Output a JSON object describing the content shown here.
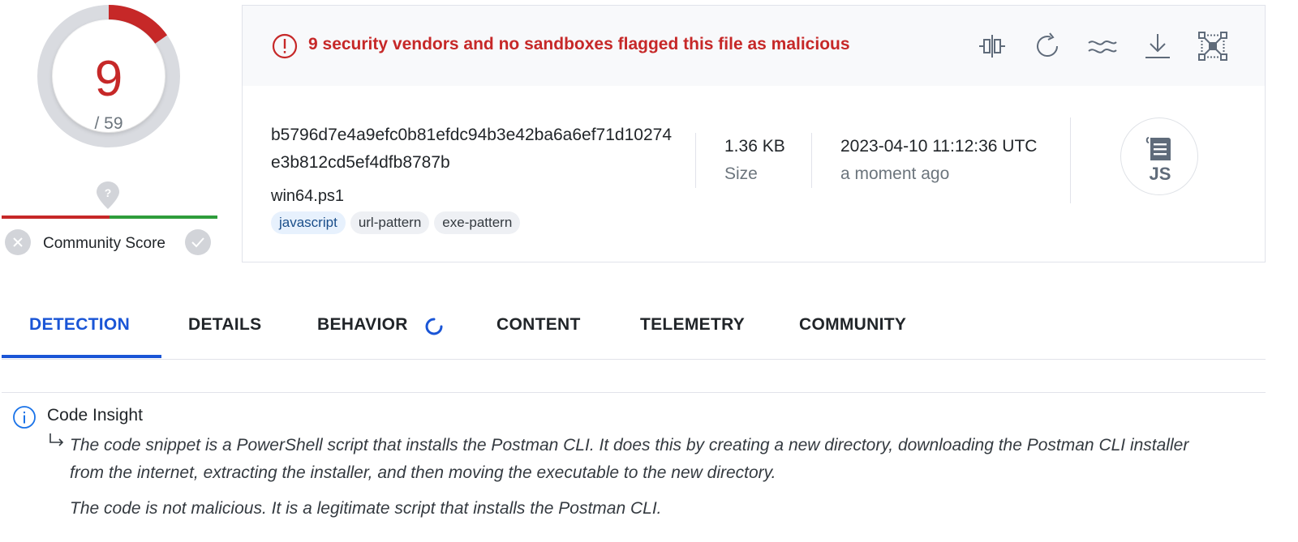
{
  "score": {
    "detections": "9",
    "total": "/ 59",
    "detection_fraction": 0.1525,
    "accent_color": "#c62828"
  },
  "community": {
    "label": "Community Score",
    "icons": [
      "question-pin-icon",
      "thumbs-down-x-icon",
      "thumbs-up-check-icon"
    ]
  },
  "alert": {
    "text": "9 security vendors and no sandboxes flagged this file as malicious",
    "icon": "exclamation-circle-icon",
    "color": "#c62828"
  },
  "toolbar": {
    "icons": [
      "compare-icon",
      "reanalyze-icon",
      "similar-icon",
      "download-icon",
      "graph-icon"
    ]
  },
  "file": {
    "hash": "b5796d7e4a9efc0b81efdc94b3e42ba6a6ef71d10274e3b812cd5ef4dfb8787b",
    "name": "win64.ps1",
    "tags": [
      "javascript",
      "url-pattern",
      "exe-pattern"
    ],
    "size_value": "1.36 KB",
    "size_label": "Size",
    "date_value": "2023-04-10 11:12:36 UTC",
    "date_label": "a moment ago",
    "type_icon": "js-file-icon",
    "type_text": "JS"
  },
  "tabs": [
    {
      "label": "DETECTION",
      "active": true
    },
    {
      "label": "DETAILS",
      "active": false
    },
    {
      "label": "BEHAVIOR",
      "active": false
    },
    {
      "label": "CONTENT",
      "active": false
    },
    {
      "label": "TELEMETRY",
      "active": false
    },
    {
      "label": "COMMUNITY",
      "active": false
    }
  ],
  "insight": {
    "title": "Code Insight",
    "paragraph1": "The code snippet is a PowerShell script that installs the Postman CLI. It does this by creating a new directory, downloading the Postman CLI installer from the internet, extracting the installer, and then moving the executable to the new directory.",
    "paragraph2": "The code is not malicious. It is a legitimate script that installs the Postman CLI."
  }
}
